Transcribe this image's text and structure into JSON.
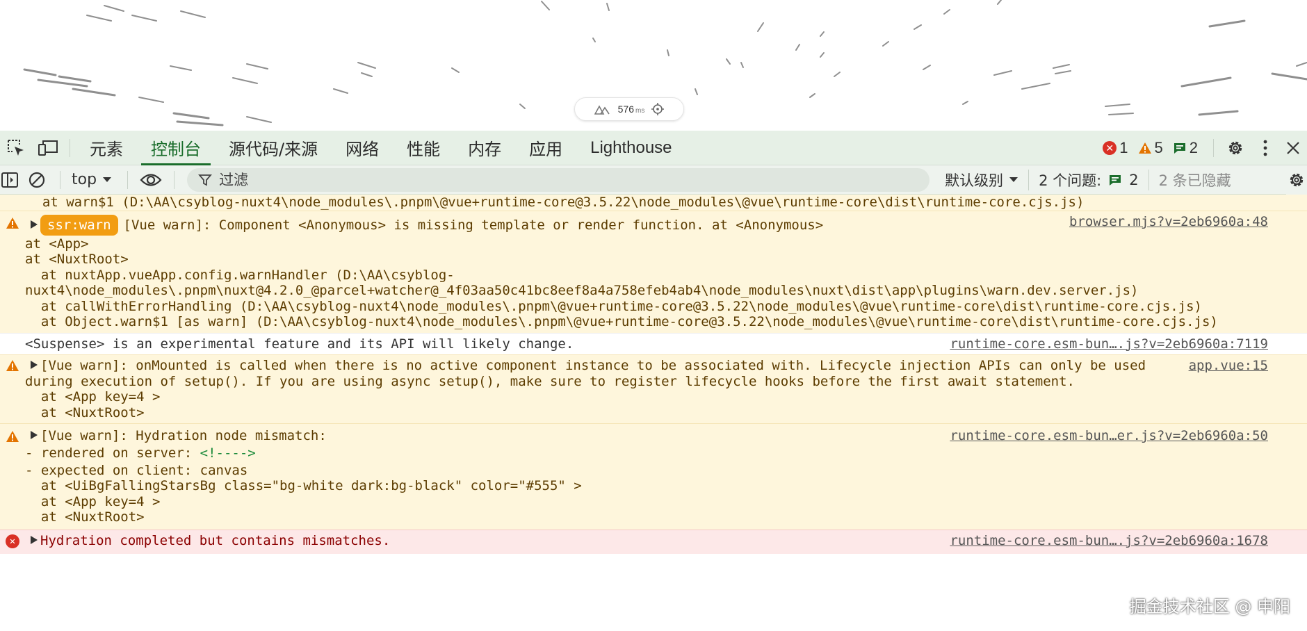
{
  "page": {
    "perf_value": "576",
    "perf_unit": "ms"
  },
  "tabs": [
    {
      "label": "元素"
    },
    {
      "label": "控制台"
    },
    {
      "label": "源代码/来源"
    },
    {
      "label": "网络"
    },
    {
      "label": "性能"
    },
    {
      "label": "内存"
    },
    {
      "label": "应用"
    },
    {
      "label": "Lighthouse"
    }
  ],
  "active_tab": "控制台",
  "counts": {
    "errors": "1",
    "warnings": "5",
    "messages": "2"
  },
  "toolbar": {
    "context": "top",
    "filter_placeholder": "过滤",
    "levels": "默认级别",
    "issues_label": "2 个问题:",
    "issues_count": "2",
    "hidden": "2 条已隐藏"
  },
  "console": {
    "top_line": "  at warn$1 (D:\\AA\\csyblog-nuxt4\\node_modules\\.pnpm\\@vue+runtime-core@3.5.22\\node_modules\\@vue\\runtime-core\\dist\\runtime-core.cjs.js)",
    "messages": [
      {
        "level": "warn",
        "badge": "ssr:warn",
        "first": "[Vue warn]: Component <Anonymous> is missing template or render function. at <Anonymous>",
        "source": "browser.mjs?v=2eb6960a:48",
        "lines": [
          "at <App>",
          "at <NuxtRoot>",
          "  at nuxtApp.vueApp.config.warnHandler (D:\\AA\\csyblog-",
          "nuxt4\\node_modules\\.pnpm\\nuxt@4.2.0_@parcel+watcher@_4f03aa50c41bc8eef8a4a758efeb4ab4\\node_modules\\nuxt\\dist\\app\\plugins\\warn.dev.server.js)",
          "  at callWithErrorHandling (D:\\AA\\csyblog-nuxt4\\node_modules\\.pnpm\\@vue+runtime-core@3.5.22\\node_modules\\@vue\\runtime-core\\dist\\runtime-core.cjs.js)",
          "  at Object.warn$1 [as warn] (D:\\AA\\csyblog-nuxt4\\node_modules\\.pnpm\\@vue+runtime-core@3.5.22\\node_modules\\@vue\\runtime-core\\dist\\runtime-core.cjs.js)"
        ]
      },
      {
        "level": "plain",
        "first": "<Suspense> is an experimental feature and its API will likely change.",
        "source": "runtime-core.esm-bun….js?v=2eb6960a:7119"
      },
      {
        "level": "warn",
        "first": "[Vue warn]: onMounted is called when there is no active component instance to be associated with. Lifecycle injection APIs can only be used",
        "source": "app.vue:15",
        "lines": [
          "during execution of setup(). If you are using async setup(), make sure to register lifecycle hooks before the first await statement.",
          "  at <App key=4 >",
          "  at <NuxtRoot>"
        ]
      },
      {
        "level": "warn",
        "first": "[Vue warn]: Hydration node mismatch:",
        "source": "runtime-core.esm-bun…er.js?v=2eb6960a:50",
        "rendered_label": "- rendered on server: ",
        "rendered_value": "<!---->",
        "lines": [
          "- expected on client: canvas",
          "  at <UiBgFallingStarsBg class=\"bg-white dark:bg-black\" color=\"#555\" >",
          "  at <App key=4 >",
          "  at <NuxtRoot>"
        ]
      },
      {
        "level": "error",
        "first": "Hydration completed but contains mismatches.",
        "source": "runtime-core.esm-bun….js?v=2eb6960a:1678"
      }
    ]
  },
  "watermark": "掘金技术社区 @ 申阳",
  "colors": {
    "devtools_bg": "#e6f0e6",
    "active_tab": "#1a6d2b",
    "warn_bg": "#fef6dc",
    "error_bg": "#fde8e8",
    "badge": "#f29d12"
  },
  "icons": [
    "inspect-icon",
    "device-toggle-icon",
    "error-icon",
    "warning-icon",
    "message-icon",
    "gear-icon",
    "more-icon",
    "close-icon",
    "sidebar-icon",
    "clear-icon",
    "eye-icon",
    "filter-icon",
    "chevron-down-icon",
    "nuxt-logo-icon",
    "crosshair-icon"
  ]
}
